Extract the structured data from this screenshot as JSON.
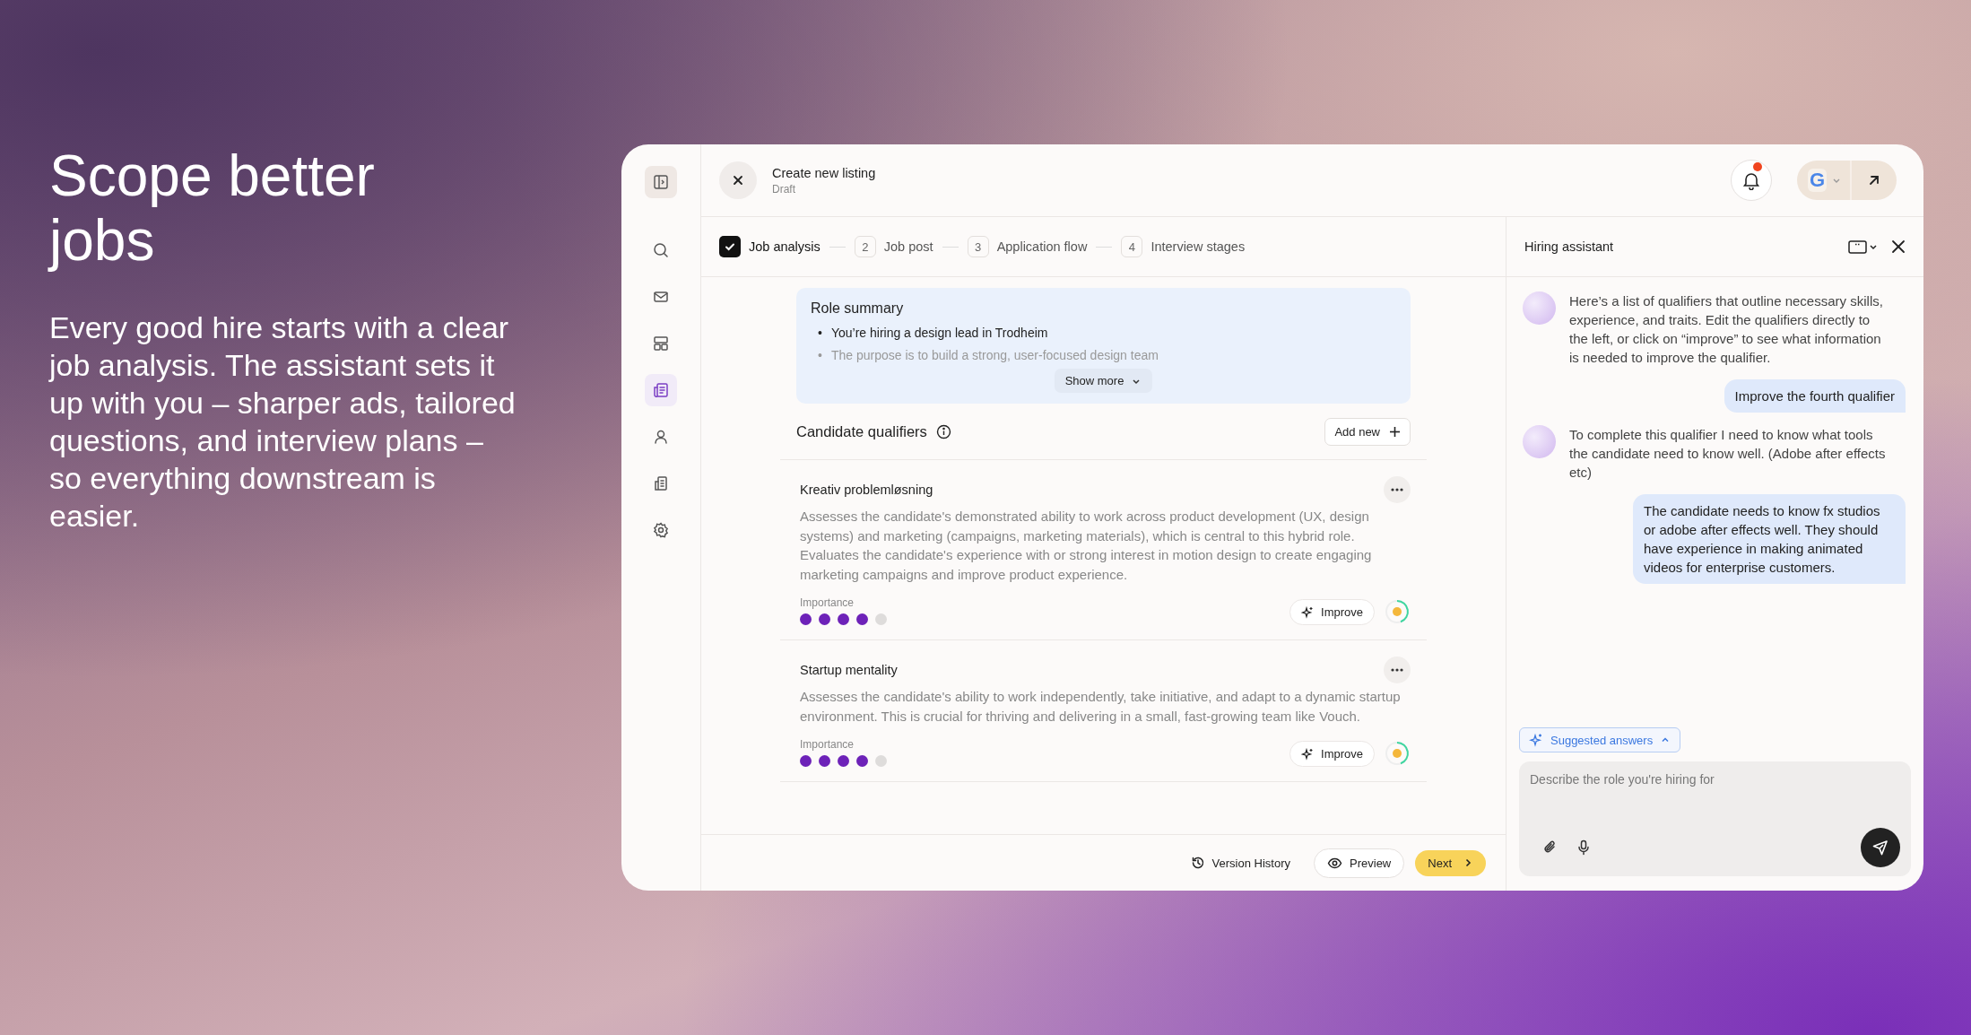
{
  "hero": {
    "title": "Scope better jobs",
    "body": "Every good hire starts with a clear job analysis. The assistant sets it up with you – sharper ads, tailored questions, and interview plans – so everything downstream is easier."
  },
  "sidebar": {
    "items": [
      {
        "selected": false
      },
      {
        "selected": false
      },
      {
        "selected": false
      },
      {
        "selected": true
      },
      {
        "selected": false
      },
      {
        "selected": false
      },
      {
        "selected": false
      }
    ]
  },
  "header": {
    "title": "Create new listing",
    "status": "Draft",
    "notifications": {
      "unread": true
    },
    "account_initial": "G"
  },
  "steps": [
    {
      "label": "Job analysis",
      "completed": true
    },
    {
      "number": "2",
      "label": "Job post",
      "completed": false
    },
    {
      "number": "3",
      "label": "Application flow",
      "completed": false
    },
    {
      "number": "4",
      "label": "Interview stages",
      "completed": false
    }
  ],
  "role_summary": {
    "title": "Role summary",
    "points": [
      {
        "bullet": "•",
        "text": "You’re hiring a design lead in Trodheim",
        "faded": false
      },
      {
        "bullet": "•",
        "text": "The purpose is to build a strong, user-focused design team",
        "faded": true
      }
    ],
    "show_more": "Show more"
  },
  "qualifiers": {
    "title": "Candidate qualifiers",
    "add_button": "Add new",
    "items": [
      {
        "name": "Kreativ problemløsning",
        "description": "Assesses the candidate's demonstrated ability to work across product development (UX, design systems) and marketing (campaigns, marketing materials), which is central to this hybrid role. Evaluates the candidate's experience with or strong interest in motion design to create engaging marketing campaigns and improve product experience.",
        "importance_label": "Importance",
        "stars": 4,
        "improve_button": "Improve"
      },
      {
        "name": "Startup mentality",
        "description": "Assesses the candidate's ability to work independently, take initiative, and adapt to a dynamic startup environment. This is crucial for thriving and delivering in a small, fast-growing team like Vouch.",
        "importance_label": "Importance",
        "stars": 4,
        "improve_button": "Improve"
      }
    ]
  },
  "footer": {
    "version_history": "Version History",
    "preview": "Preview",
    "next": "Next"
  },
  "assistant": {
    "title": "Hiring assistant",
    "messages": [
      {
        "kind": "assistant",
        "text": "Here’s a list of qualifiers that outline necessary skills, experience, and traits. Edit the qualifiers directly to the left, or click on “improve” to see what information is needed to improve the qualifier."
      },
      {
        "kind": "user",
        "text": "Improve the fourth qualifier"
      },
      {
        "kind": "assistant",
        "text": "To complete this qualifier I need to know what tools the candidate need to know well. (Adobe after effects etc)"
      },
      {
        "kind": "user",
        "text": "The candidate needs to know fx studios or adobe after effects well. They should have experience in making animated videos for enterprise customers."
      }
    ],
    "suggested": {
      "label": "Suggested answers",
      "expanded": true
    },
    "input": {
      "placeholder": "Describe the role you're hiring for"
    }
  }
}
